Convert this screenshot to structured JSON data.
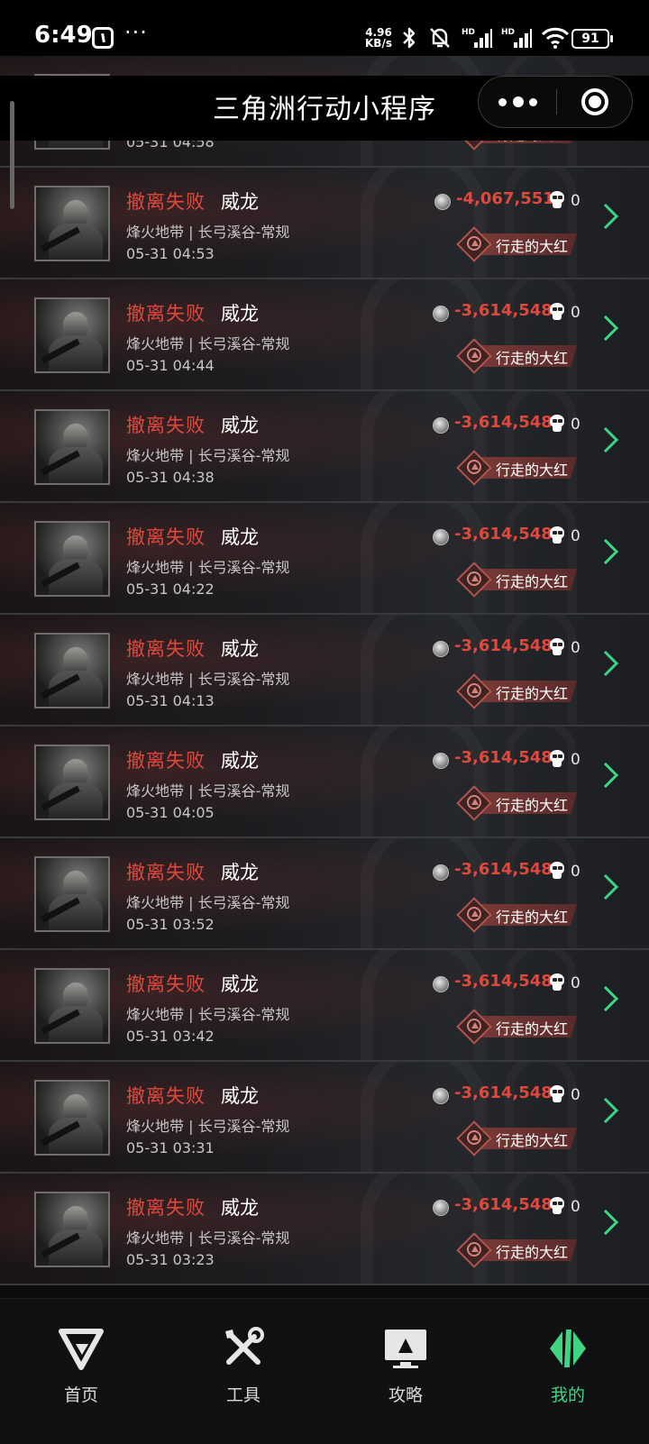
{
  "status_bar": {
    "time": "6:49",
    "more": "···",
    "net_speed_value": "4.96",
    "net_speed_unit": "KB/s",
    "battery": "91"
  },
  "title_bar": {
    "title": "三角洲行动小程序"
  },
  "colors": {
    "accent_green": "#3fd383",
    "fail_red": "#e0483e",
    "badge_red": "#7a3a37",
    "background": "#0d0d0f"
  },
  "icons": {
    "coin": "coin-icon",
    "skull": "skull-icon",
    "rank": "rank-badge-icon",
    "chevron": "chevron-right-icon"
  },
  "records": [
    {
      "status": "",
      "operator": "",
      "mode": "",
      "time": "05-31 04:58",
      "value": "",
      "kills": "",
      "rank": "行走的大红"
    },
    {
      "status": "撤离失败",
      "operator": "威龙",
      "mode": "烽火地带 | 长弓溪谷-常规",
      "time": "05-31 04:53",
      "value": "-4,067,551",
      "kills": "0",
      "rank": "行走的大红"
    },
    {
      "status": "撤离失败",
      "operator": "威龙",
      "mode": "烽火地带 | 长弓溪谷-常规",
      "time": "05-31 04:44",
      "value": "-3,614,548",
      "kills": "0",
      "rank": "行走的大红"
    },
    {
      "status": "撤离失败",
      "operator": "威龙",
      "mode": "烽火地带 | 长弓溪谷-常规",
      "time": "05-31 04:38",
      "value": "-3,614,548",
      "kills": "0",
      "rank": "行走的大红"
    },
    {
      "status": "撤离失败",
      "operator": "威龙",
      "mode": "烽火地带 | 长弓溪谷-常规",
      "time": "05-31 04:22",
      "value": "-3,614,548",
      "kills": "0",
      "rank": "行走的大红"
    },
    {
      "status": "撤离失败",
      "operator": "威龙",
      "mode": "烽火地带 | 长弓溪谷-常规",
      "time": "05-31 04:13",
      "value": "-3,614,548",
      "kills": "0",
      "rank": "行走的大红"
    },
    {
      "status": "撤离失败",
      "operator": "威龙",
      "mode": "烽火地带 | 长弓溪谷-常规",
      "time": "05-31 04:05",
      "value": "-3,614,548",
      "kills": "0",
      "rank": "行走的大红"
    },
    {
      "status": "撤离失败",
      "operator": "威龙",
      "mode": "烽火地带 | 长弓溪谷-常规",
      "time": "05-31 03:52",
      "value": "-3,614,548",
      "kills": "0",
      "rank": "行走的大红"
    },
    {
      "status": "撤离失败",
      "operator": "威龙",
      "mode": "烽火地带 | 长弓溪谷-常规",
      "time": "05-31 03:42",
      "value": "-3,614,548",
      "kills": "0",
      "rank": "行走的大红"
    },
    {
      "status": "撤离失败",
      "operator": "威龙",
      "mode": "烽火地带 | 长弓溪谷-常规",
      "time": "05-31 03:31",
      "value": "-3,614,548",
      "kills": "0",
      "rank": "行走的大红"
    },
    {
      "status": "撤离失败",
      "operator": "威龙",
      "mode": "烽火地带 | 长弓溪谷-常规",
      "time": "05-31 03:23",
      "value": "-3,614,548",
      "kills": "0",
      "rank": "行走的大红"
    }
  ],
  "bottom_nav": {
    "tabs": [
      {
        "label": "首页",
        "icon": "home-v-logo-icon",
        "active": false
      },
      {
        "label": "工具",
        "icon": "tools-icon",
        "active": false
      },
      {
        "label": "攻略",
        "icon": "guide-monitor-icon",
        "active": false
      },
      {
        "label": "我的",
        "icon": "profile-logo-icon",
        "active": true
      }
    ]
  }
}
